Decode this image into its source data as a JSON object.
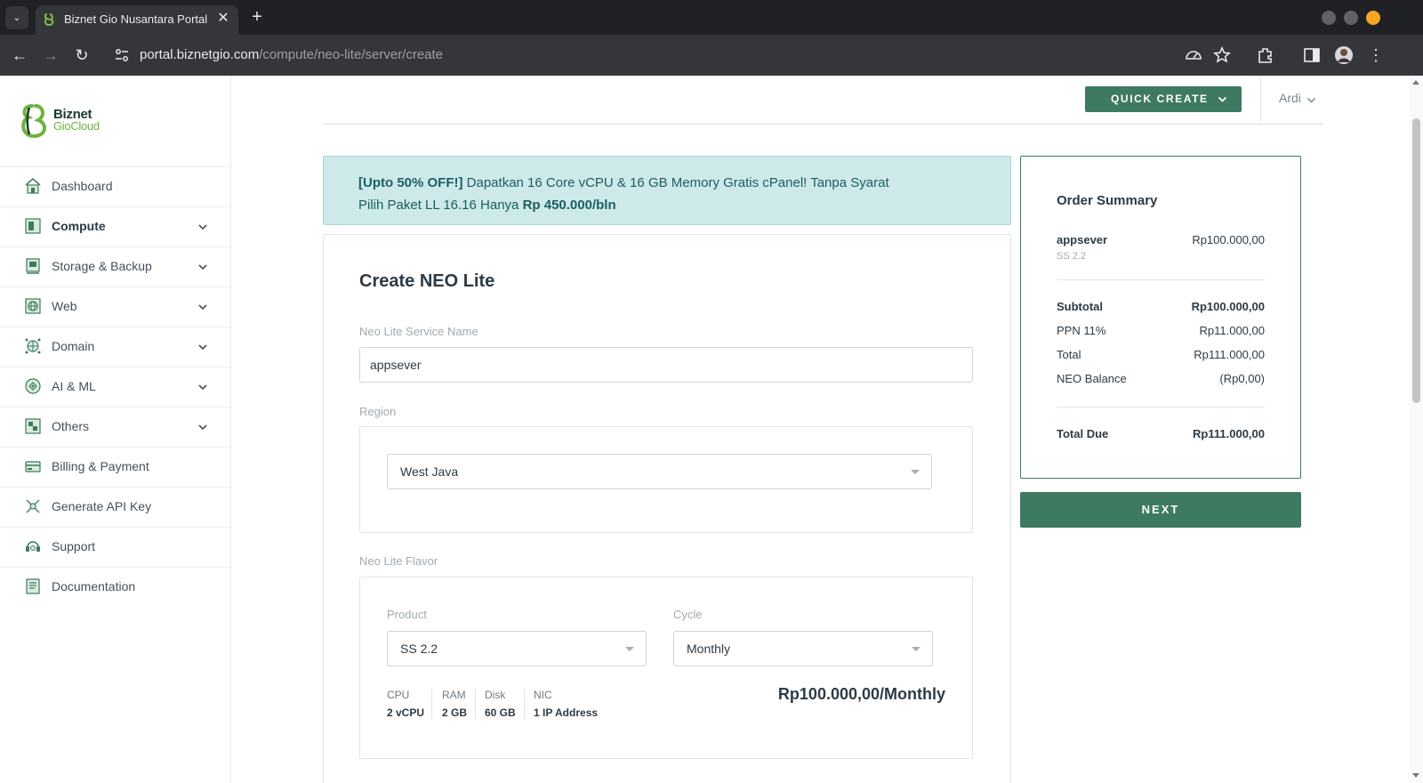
{
  "browser": {
    "tab_title": "Biznet Gio Nusantara Portal",
    "url_host": "portal.biznetgio.com",
    "url_path": "/compute/neo-lite/server/create"
  },
  "brand": {
    "line1": "Biznet",
    "line2": "GioCloud",
    "accent": "#3e7a61"
  },
  "sidebar": {
    "items": [
      {
        "label": "Dashboard",
        "icon": "home-icon"
      },
      {
        "label": "Compute",
        "icon": "compute-icon"
      },
      {
        "label": "Storage & Backup",
        "icon": "storage-icon"
      },
      {
        "label": "Web",
        "icon": "web-icon"
      },
      {
        "label": "Domain",
        "icon": "domain-icon"
      },
      {
        "label": "AI & ML",
        "icon": "ai-icon"
      },
      {
        "label": "Others",
        "icon": "others-icon"
      },
      {
        "label": "Billing & Payment",
        "icon": "billing-icon"
      },
      {
        "label": "Generate API Key",
        "icon": "api-key-icon"
      },
      {
        "label": "Support",
        "icon": "support-icon"
      },
      {
        "label": "Documentation",
        "icon": "documentation-icon"
      }
    ]
  },
  "header": {
    "quick_create": "QUICK CREATE",
    "user": "Ardi"
  },
  "promo": {
    "bold1": "[Upto 50% OFF!]",
    "text1": " Dapatkan 16 Core vCPU & 16 GB Memory Gratis cPanel! Tanpa Syarat",
    "text2": "Pilih Paket LL 16.16 Hanya ",
    "bold2": "Rp 450.000/bln"
  },
  "form": {
    "title": "Create NEO Lite",
    "service_name_label": "Neo Lite Service Name",
    "service_name_value": "appsever",
    "region_label": "Region",
    "region_value": "West Java",
    "flavor_label": "Neo Lite Flavor",
    "product_label": "Product",
    "product_value": "SS 2.2",
    "cycle_label": "Cycle",
    "cycle_value": "Monthly",
    "specs": [
      {
        "key": "CPU",
        "value": "2 vCPU"
      },
      {
        "key": "RAM",
        "value": "2 GB"
      },
      {
        "key": "Disk",
        "value": "60 GB"
      },
      {
        "key": "NIC",
        "value": "1 IP Address"
      }
    ],
    "price": "Rp100.000,00/Monthly"
  },
  "summary": {
    "title": "Order Summary",
    "item_name": "appsever",
    "item_price": "Rp100.000,00",
    "item_sub": "SS 2.2",
    "subtotal_label": "Subtotal",
    "subtotal_value": "Rp100.000,00",
    "ppn_label": "PPN 11%",
    "ppn_value": "Rp11.000,00",
    "total_label": "Total",
    "total_value": "Rp111.000,00",
    "balance_label": "NEO Balance",
    "balance_value": "(Rp0,00)",
    "due_label": "Total Due",
    "due_value": "Rp111.000,00"
  },
  "next_button": "NEXT"
}
